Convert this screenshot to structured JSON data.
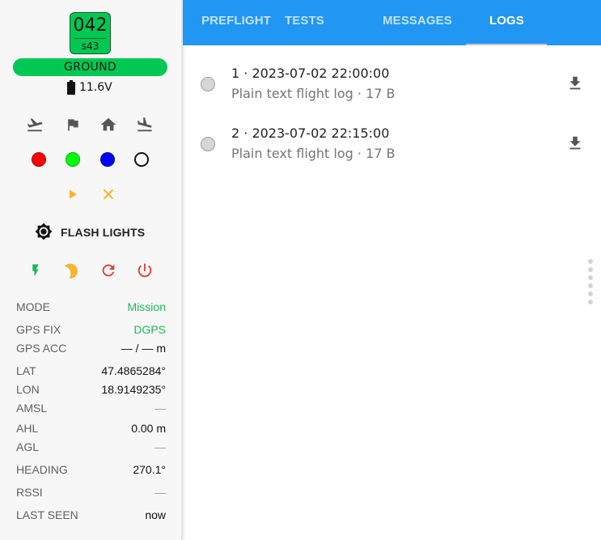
{
  "uav": {
    "id": "042",
    "sub_id": "s43",
    "status": "GROUND",
    "status_color": "#00c853",
    "battery": "11.6V"
  },
  "command_icons": [
    "takeoff-icon",
    "flag-icon",
    "home-icon",
    "land-icon"
  ],
  "color_icons": [
    {
      "name": "red-light-icon",
      "color": "#ff0000"
    },
    {
      "name": "green-light-icon",
      "color": "#00ff00"
    },
    {
      "name": "blue-light-icon",
      "color": "#0000ff"
    },
    {
      "name": "off-light-icon",
      "color": "#ffffff"
    }
  ],
  "playback_icons": [
    "play-icon",
    "close-icon"
  ],
  "flash_label": "FLASH LIGHTS",
  "power_icons": [
    "motor-on-icon",
    "sleep-icon",
    "reset-icon",
    "power-off-icon"
  ],
  "stats": [
    {
      "key": "MODE",
      "value": "Mission",
      "highlight": true
    },
    {
      "key": "GPS FIX",
      "value": "DGPS",
      "highlight": true
    },
    {
      "key": "GPS ACC",
      "value": "— / — m",
      "highlight": false
    },
    {
      "key": "LAT",
      "value": "47.4865284°",
      "highlight": false
    },
    {
      "key": "LON",
      "value": "18.9149235°",
      "highlight": false
    },
    {
      "key": "AMSL",
      "value": "—",
      "highlight": false
    },
    {
      "key": "AHL",
      "value": "0.00 m",
      "highlight": false
    },
    {
      "key": "AGL",
      "value": "—",
      "highlight": false
    },
    {
      "key": "HEADING",
      "value": "270.1°",
      "highlight": false
    },
    {
      "key": "RSSI",
      "value": "—",
      "highlight": false
    },
    {
      "key": "LAST SEEN",
      "value": "now",
      "highlight": false
    }
  ],
  "tabs": [
    {
      "label": "PREFLIGHT",
      "active": false
    },
    {
      "label": "TESTS",
      "active": false
    },
    {
      "label": "MESSAGES",
      "active": false
    },
    {
      "label": "LOGS",
      "active": true
    }
  ],
  "logs": [
    {
      "title": "1 · 2023-07-02 22:00:00",
      "subtitle": "Plain text flight log · 17 B"
    },
    {
      "title": "2 · 2023-07-02 22:15:00",
      "subtitle": "Plain text flight log · 17 B"
    }
  ],
  "colors": {
    "accent": "#2196f3",
    "ok_green": "#00c853",
    "text_green": "#1db954",
    "warning_amber": "#f9b42d",
    "danger_red": "#e53935"
  }
}
